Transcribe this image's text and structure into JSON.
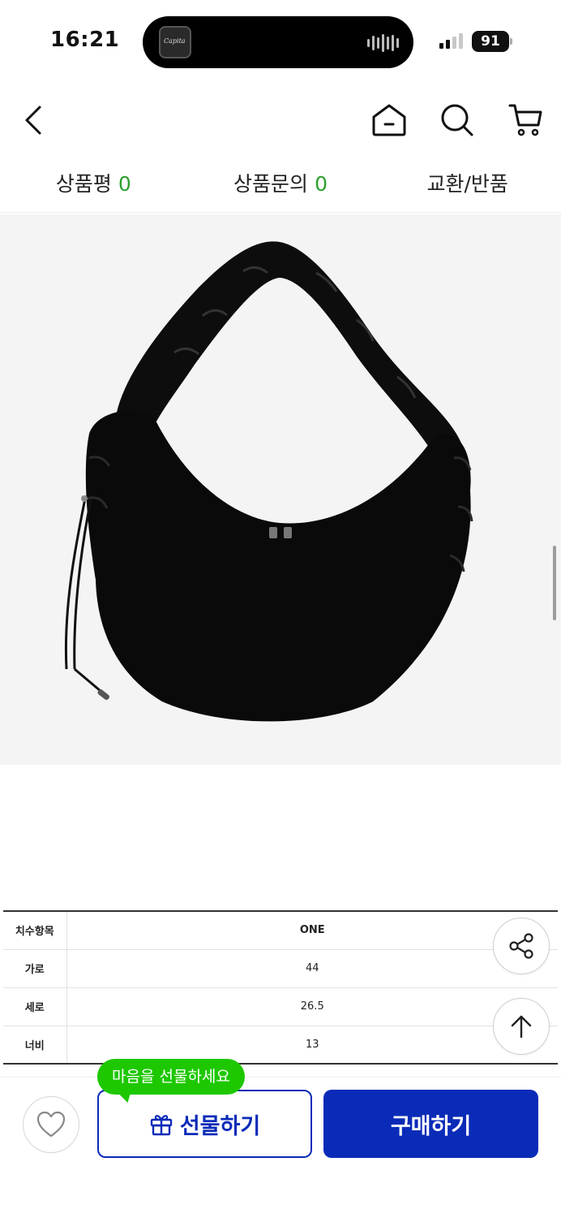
{
  "status_bar": {
    "time": "16:21",
    "battery": "91",
    "island_thumb_text": "Capita"
  },
  "header": {
    "back_icon": "chevron-left-icon",
    "home_icon": "home-icon",
    "search_icon": "search-icon",
    "cart_icon": "cart-icon"
  },
  "tabs": [
    {
      "label": "상품평",
      "count": "0"
    },
    {
      "label": "상품문의",
      "count": "0"
    },
    {
      "label": "교환/반품",
      "count": ""
    }
  ],
  "product": {
    "image_alt": "black hobo shoulder bag"
  },
  "size_table": {
    "header": {
      "label": "치수항목",
      "value": "ONE"
    },
    "rows": [
      {
        "label": "가로",
        "value": "44"
      },
      {
        "label": "세로",
        "value": "26.5"
      },
      {
        "label": "너비",
        "value": "13"
      }
    ]
  },
  "bottom_bar": {
    "gift_bubble": "마음을 선물하세요",
    "gift_label": "선물하기",
    "buy_label": "구매하기"
  },
  "colors": {
    "accent_blue": "#0a2bb8",
    "bubble_green": "#1ec800",
    "count_green": "#2ca02c"
  }
}
